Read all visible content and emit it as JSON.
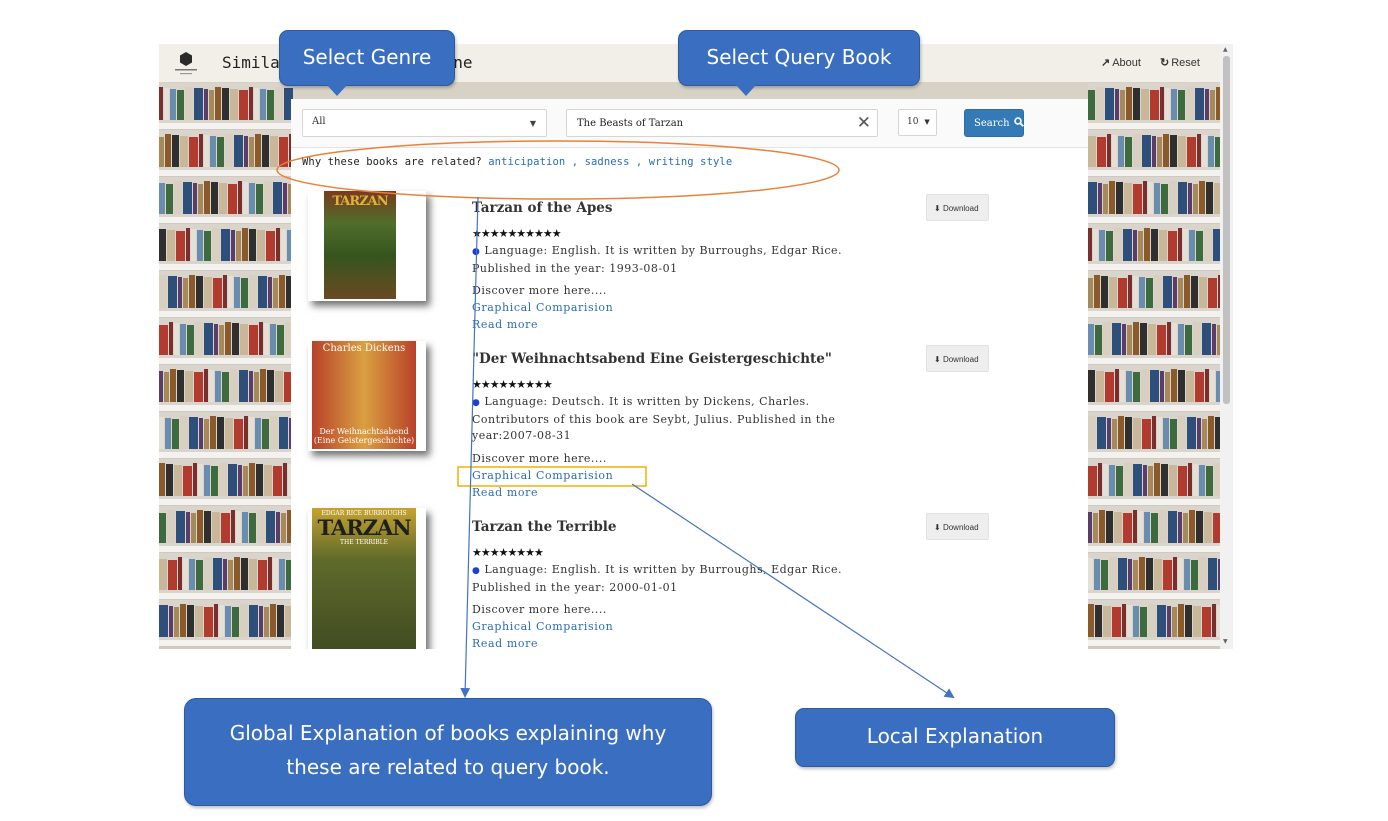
{
  "navbar": {
    "title": "Similar Book Search Engine",
    "about_label": "About",
    "reset_label": "Reset",
    "about_icon": "external-link-icon",
    "reset_icon": "refresh-icon"
  },
  "search": {
    "genre_value": "All",
    "query_value": "The Beasts of Tarzan",
    "count_value": "10",
    "search_label": "Search"
  },
  "why": {
    "prefix": "Why these books are related? ",
    "keywords": [
      "anticipation",
      "sadness",
      "writing style"
    ]
  },
  "results": [
    {
      "title": "Tarzan of the Apes",
      "stars": "★★★★★★★★★★",
      "description": "Language: English. It is written by Burroughs, Edgar Rice. Published in the year: 1993-08-01",
      "discover": "Discover more here....",
      "graph_link": "Graphical Comparision",
      "read_more": "Read more",
      "download_label": "Download",
      "cover_text": "TARZAN"
    },
    {
      "title": "\"Der Weihnachtsabend Eine Geistergeschichte\"",
      "stars": "★★★★★★★★★",
      "description": "Language: Deutsch. It is written by Dickens, Charles. Contributors of this book are Seybt, Julius. Published in the year:2007-08-31",
      "discover": "Discover more here....",
      "graph_link": "Graphical Comparision",
      "read_more": "Read more",
      "download_label": "Download",
      "cover_text_top": "Charles Dickens",
      "cover_text_bottom": "Der Weihnachtsabend (Eine Geistergeschichte)"
    },
    {
      "title": "Tarzan the Terrible",
      "stars": "★★★★★★★★",
      "description": "Language: English. It is written by Burroughs, Edgar Rice. Published in the year: 2000-01-01",
      "discover": "Discover more here....",
      "graph_link": "Graphical Comparision",
      "read_more": "Read more",
      "download_label": "Download",
      "cover_text_top": "EDGAR RICE BURROUGHS",
      "cover_text": "TARZAN",
      "cover_text_sub": "THE TERRIBLE"
    }
  ],
  "annotations": {
    "select_genre": "Select Genre",
    "select_query_book": "Select Query Book",
    "global_explanation": "Global Explanation of books explaining why these are related to query book.",
    "local_explanation": "Local Explanation"
  },
  "colors": {
    "link": "#2a6cb8",
    "button_primary": "#337ab7",
    "callout": "#3a6ec0",
    "ellipse": "#e8823a",
    "highlight_box": "#f0b400",
    "arrow": "#4472c4"
  }
}
